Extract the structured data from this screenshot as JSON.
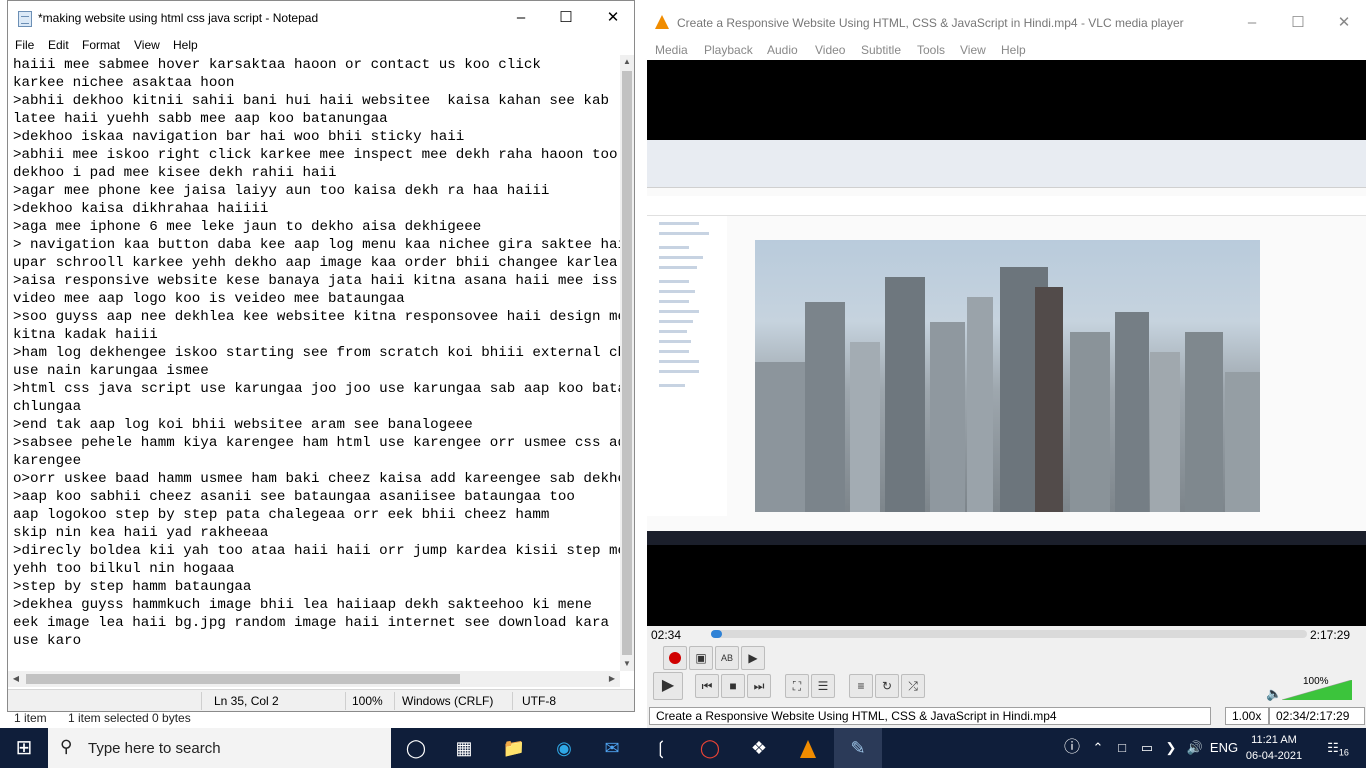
{
  "background_explorer": {
    "status_items": "1 item",
    "status_selected": "1 item selected  0 bytes"
  },
  "notepad": {
    "title": "*making website using html css java script - Notepad",
    "menu": [
      "File",
      "Edit",
      "Format",
      "View",
      "Help"
    ],
    "lines": [
      "haiii mee sabmee hover karsaktaa haoon or contact us koo click",
      "karkee nichee asaktaa hoon",
      ">abhii dekhoo kitnii sahii bani hui haii websitee  kaisa kahan see kab",
      "latee haii yuehh sabb mee aap koo batanungaa",
      ">dekhoo iskaa navigation bar hai woo bhii sticky haii",
      ">abhii mee iskoo right click karkee mee inspect mee dekh raha haoon too",
      "dekhoo i pad mee kisee dekh rahii haii",
      ">agar mee phone kee jaisa laiyy aun too kaisa dekh ra haa haiii",
      ">dekhoo kaisa dikhrahaa haiiii",
      ">aga mee iphone 6 mee leke jaun to dekho aisa dekhigeee",
      "> navigation kaa button daba kee aap log menu kaa nichee gira saktee hai",
      "upar schrooll karkee yehh dekho aap image kaa order bhii changee karlea",
      ">aisa responsive website kese banaya jata haii kitna asana haii mee iss",
      "video mee aap logo koo is veideo mee bataungaa",
      ">soo guyss aap nee dekhlea kee websitee kitna responsovee haii design mee",
      "kitna kadak haiii",
      ">ham log dekhengee iskoo starting see from scratch koi bhiii external cheez",
      "use nain karungaa ismee",
      ">html css java script use karungaa joo joo use karungaa sab aap koo batatee",
      "chlungaa",
      ">end tak aap log koi bhii websitee aram see banalogeee",
      ">sabsee pehele hamm kiya karengee ham html use karengee orr usmee css add",
      "karengee",
      "o>orr uskee baad hamm usmee ham baki cheez kaisa add kareengee sab dekhenge",
      ">aap koo sabhii cheez asanii see bataungaa asaniisee bataungaa too",
      "aap logokoo step by step pata chalegeaa orr eek bhii cheez hamm",
      "skip nin kea haii yad rakheeaa",
      ">direcly boldea kii yah too ataa haii haii orr jump kardea kisii step mee",
      "yehh too bilkul nin hogaaa",
      ">step by step hamm bataungaa",
      ">dekhea guyss hammkuch image bhii lea haiiaap dekh sakteehoo ki mene",
      "eek image lea haii bg.jpg random image haii internet see download kara",
      "use karo",
      "",
      ">"
    ],
    "status": {
      "position": "Ln 35, Col 2",
      "zoom": "100%",
      "line_ending": "Windows (CRLF)",
      "encoding": "UTF-8"
    }
  },
  "vlc": {
    "title": "Create a Responsive Website Using HTML, CSS & JavaScript in Hindi.mp4 - VLC media player",
    "menu": [
      "Media",
      "Playback",
      "Audio",
      "Video",
      "Subtitle",
      "Tools",
      "View",
      "Help"
    ],
    "time_elapsed": "02:34",
    "time_total": "2:17:29",
    "progress_fraction": 0.019,
    "volume": "100%",
    "volume_fraction": 1.0,
    "status_file": "Create a Responsive Website Using HTML, CSS & JavaScript in Hindi.mp4",
    "speed": "1.00x",
    "status_time": "02:34/2:17:29"
  },
  "taskbar": {
    "search_placeholder": "Type here to search",
    "language": "ENG",
    "time": "11:21 AM",
    "date": "06-04-2021",
    "notification_count": "16"
  },
  "colors": {
    "taskbar_bg": "#0f1e3a",
    "vlc_progress": "#2f82d6",
    "vlc_record": "#d00000",
    "volume_green": "#3cc43c"
  }
}
